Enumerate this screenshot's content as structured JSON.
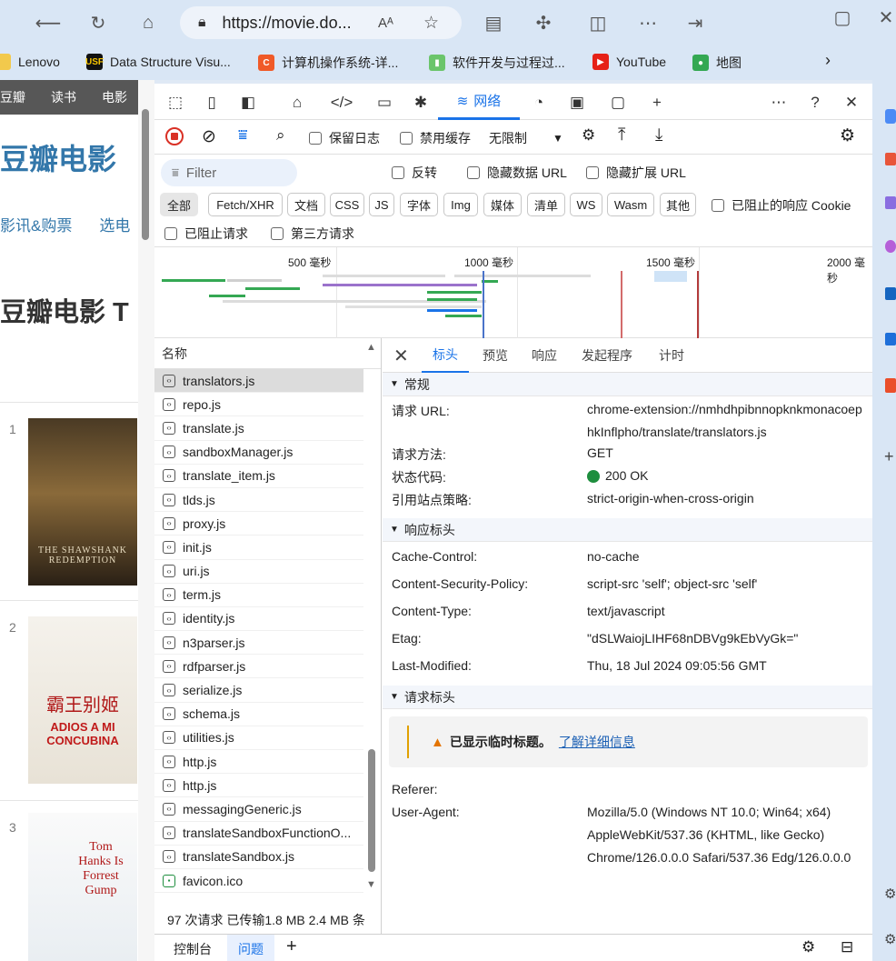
{
  "browser": {
    "address": "https://movie.do...",
    "read_aloud": "Aᴬ",
    "bookmarks": [
      "Lenovo",
      "Data Structure Visu...",
      "计算机操作系统-详...",
      "软件开发与过程过...",
      "YouTube",
      "地图"
    ]
  },
  "page": {
    "nav": [
      "豆瓣",
      "读书",
      "电影"
    ],
    "logo": "豆瓣电影",
    "subnav": [
      "影讯&购票",
      "选电"
    ],
    "heading": "豆瓣电影 T",
    "movies": [
      {
        "num": "1",
        "poster_text": "THE SHAWSHANK REDEMPTION"
      },
      {
        "num": "2",
        "poster_text": "ADIOS A MI CONCUBINA",
        "poster_title": "霸王别姬"
      },
      {
        "num": "3",
        "poster_text": "Tom Hanks Is Forrest Gump"
      }
    ]
  },
  "devtools": {
    "network_tab": "网络",
    "toolbar": {
      "preserve_log": "保留日志",
      "disable_cache": "禁用缓存",
      "throttle": "无限制"
    },
    "filter": {
      "placeholder": "Filter",
      "invert": "反转",
      "hide_data_url": "隐藏数据 URL",
      "hide_ext_url": "隐藏扩展 URL",
      "types": [
        "全部",
        "Fetch/XHR",
        "文档",
        "CSS",
        "JS",
        "字体",
        "Img",
        "媒体",
        "清单",
        "WS",
        "Wasm",
        "其他"
      ],
      "blocked_cookies": "已阻止的响应 Cookie",
      "blocked_requests": "已阻止请求",
      "third_party": "第三方请求"
    },
    "timeline": {
      "labels": [
        "500 毫秒",
        "1000 毫秒",
        "1500 毫秒",
        "2000 毫秒"
      ]
    },
    "requests": {
      "header": "名称",
      "items": [
        "translators.js",
        "repo.js",
        "translate.js",
        "sandboxManager.js",
        "translate_item.js",
        "tlds.js",
        "proxy.js",
        "init.js",
        "uri.js",
        "term.js",
        "identity.js",
        "n3parser.js",
        "rdfparser.js",
        "serialize.js",
        "schema.js",
        "utilities.js",
        "http.js",
        "http.js",
        "messagingGeneric.js",
        "translateSandboxFunctionO...",
        "translateSandbox.js",
        "favicon.ico"
      ]
    },
    "status_bar": "97 次请求  已传输1.8 MB  2.4 MB 条",
    "detail": {
      "tabs": [
        "标头",
        "预览",
        "响应",
        "发起程序",
        "计时"
      ],
      "general": {
        "title": "常规",
        "rows": [
          {
            "k": "请求 URL:",
            "v": "chrome-extension://nmhdhpibnnopknkmonacoephkInflpho/translate/translators.js"
          },
          {
            "k": "请求方法:",
            "v": "GET"
          },
          {
            "k": "状态代码:",
            "v": "200 OK"
          },
          {
            "k": "引用站点策略:",
            "v": "strict-origin-when-cross-origin"
          }
        ]
      },
      "response": {
        "title": "响应标头",
        "rows": [
          {
            "k": "Cache-Control:",
            "v": "no-cache"
          },
          {
            "k": "Content-Security-Policy:",
            "v": "script-src 'self'; object-src 'self'"
          },
          {
            "k": "Content-Type:",
            "v": "text/javascript"
          },
          {
            "k": "Etag:",
            "v": "\"dSLWaiojLIHF68nDBVg9kEbVyGk=\""
          },
          {
            "k": "Last-Modified:",
            "v": "Thu, 18 Jul 2024 09:05:56 GMT"
          }
        ]
      },
      "request": {
        "title": "请求标头",
        "warning": "已显示临时标题。",
        "warning_link": "了解详细信息",
        "rows": [
          {
            "k": "Referer:",
            "v": ""
          },
          {
            "k": "User-Agent:",
            "v": "Mozilla/5.0 (Windows NT 10.0; Win64; x64) AppleWebKit/537.36 (KHTML, like Gecko) Chrome/126.0.0.0 Safari/537.36 Edg/126.0.0.0"
          }
        ]
      }
    },
    "drawer": {
      "tabs": [
        "控制台",
        "问题"
      ]
    }
  },
  "colors": {
    "accent": "#1a73e8",
    "douban_blue": "#3377aa",
    "status_ok": "#1e8e3e",
    "warning": "#e37400"
  }
}
